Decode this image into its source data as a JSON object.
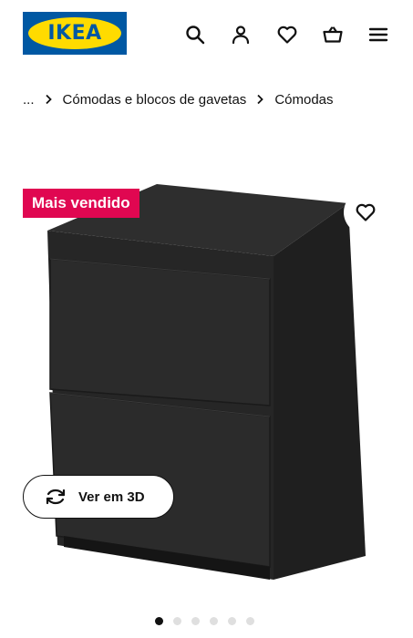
{
  "header": {
    "logo_text": "IKEA",
    "icons": [
      "search-icon",
      "user-icon",
      "heart-icon",
      "basket-icon",
      "menu-icon"
    ]
  },
  "breadcrumb": {
    "ellipsis": "...",
    "items": [
      "Cómodas e blocos de gavetas",
      "Cómodas"
    ]
  },
  "product": {
    "badge": "Mais vendido",
    "view3d_label": "Ver em 3D",
    "carousel": {
      "total": 6,
      "active": 1
    }
  },
  "colors": {
    "ikea_blue": "#0058a3",
    "ikea_yellow": "#ffdb00",
    "badge": "#e00751",
    "dresser": "#2a2a2a"
  }
}
